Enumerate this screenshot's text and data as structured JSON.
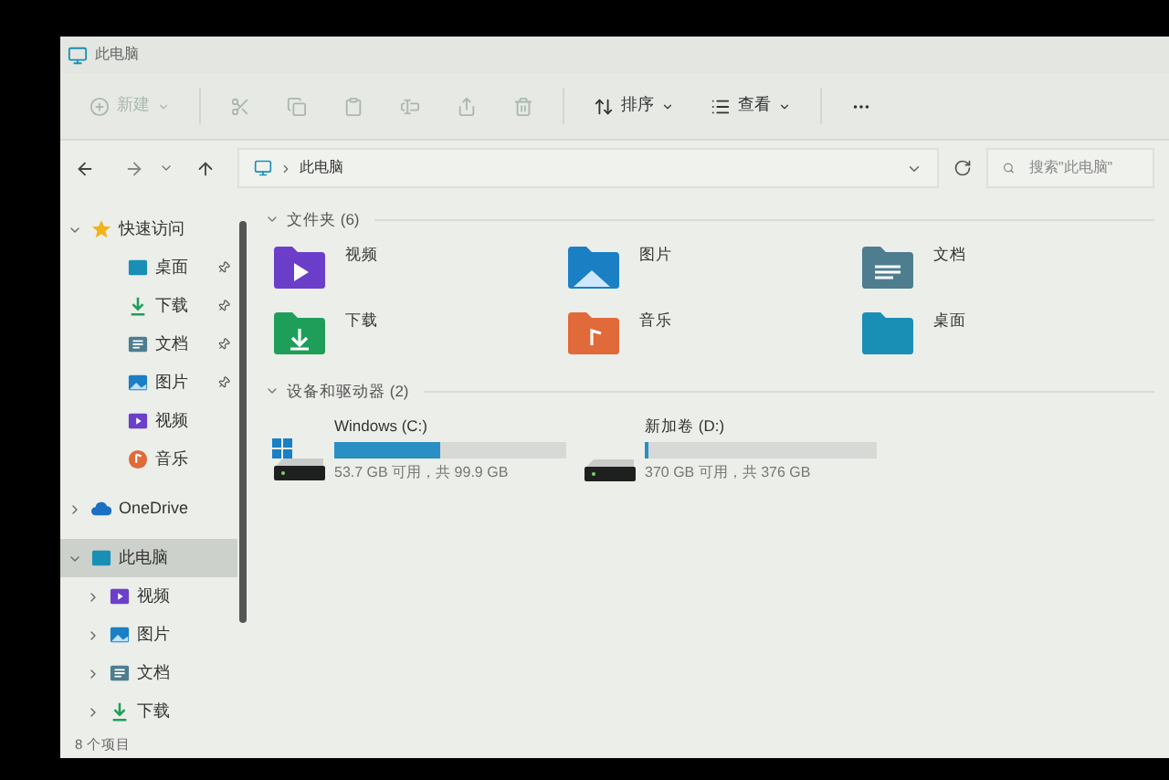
{
  "window": {
    "title": "此电脑"
  },
  "toolbar": [
    {
      "kind": "new",
      "label": "新建",
      "disabled": true
    },
    {
      "kind": "cut",
      "disabled": true
    },
    {
      "kind": "copy",
      "disabled": true
    },
    {
      "kind": "paste",
      "disabled": true
    },
    {
      "kind": "rename",
      "disabled": true
    },
    {
      "kind": "share",
      "disabled": true
    },
    {
      "kind": "delete",
      "disabled": true
    },
    {
      "kind": "sort",
      "label": "排序",
      "disabled": false
    },
    {
      "kind": "view",
      "label": "查看",
      "disabled": false
    },
    {
      "kind": "more",
      "disabled": false
    }
  ],
  "address": {
    "path": "此电脑",
    "search_placeholder": "搜索\"此电脑\""
  },
  "sidebar": [
    {
      "kind": "star",
      "label": "快速访问",
      "expanded": true,
      "selected": false,
      "children": [
        {
          "kind": "desktop",
          "label": "桌面",
          "pinned": true,
          "selected": false
        },
        {
          "kind": "download",
          "label": "下载",
          "pinned": true,
          "selected": false
        },
        {
          "kind": "documents",
          "label": "文档",
          "pinned": true,
          "selected": false
        },
        {
          "kind": "pictures",
          "label": "图片",
          "pinned": true,
          "selected": false
        },
        {
          "kind": "videos",
          "label": "视频",
          "pinned": false,
          "selected": false
        },
        {
          "kind": "music",
          "label": "音乐",
          "pinned": false,
          "selected": false
        }
      ]
    },
    {
      "kind": "cloud",
      "label": "OneDrive",
      "expanded": false,
      "selected": false
    },
    {
      "kind": "pc",
      "label": "此电脑",
      "expanded": true,
      "selected": true,
      "children": [
        {
          "kind": "videos",
          "label": "视频",
          "expanded": false,
          "selected": false
        },
        {
          "kind": "pictures",
          "label": "图片",
          "expanded": false,
          "selected": false
        },
        {
          "kind": "documents",
          "label": "文档",
          "expanded": false,
          "selected": false
        },
        {
          "kind": "download",
          "label": "下载",
          "expanded": false,
          "selected": false
        }
      ]
    }
  ],
  "folders": {
    "title": "文件夹 (6)",
    "expanded": true,
    "items": [
      {
        "kind": "videos",
        "label": "视频"
      },
      {
        "kind": "pictures",
        "label": "图片"
      },
      {
        "kind": "documents",
        "label": "文档"
      },
      {
        "kind": "download",
        "label": "下载"
      },
      {
        "kind": "music",
        "label": "音乐"
      },
      {
        "kind": "desktop",
        "label": "桌面"
      }
    ]
  },
  "drives": {
    "title": "设备和驱动器 (2)",
    "expanded": true,
    "items": [
      {
        "kind": "system",
        "label": "Windows (C:)",
        "level": 0.46,
        "reading": "53.7 GB 可用，共 99.9 GB"
      },
      {
        "kind": "data",
        "label": "新加卷 (D:)",
        "level": 0.016,
        "reading": "370 GB 可用，共 376 GB"
      }
    ]
  },
  "status_bar": {
    "text": "8 个项目"
  }
}
